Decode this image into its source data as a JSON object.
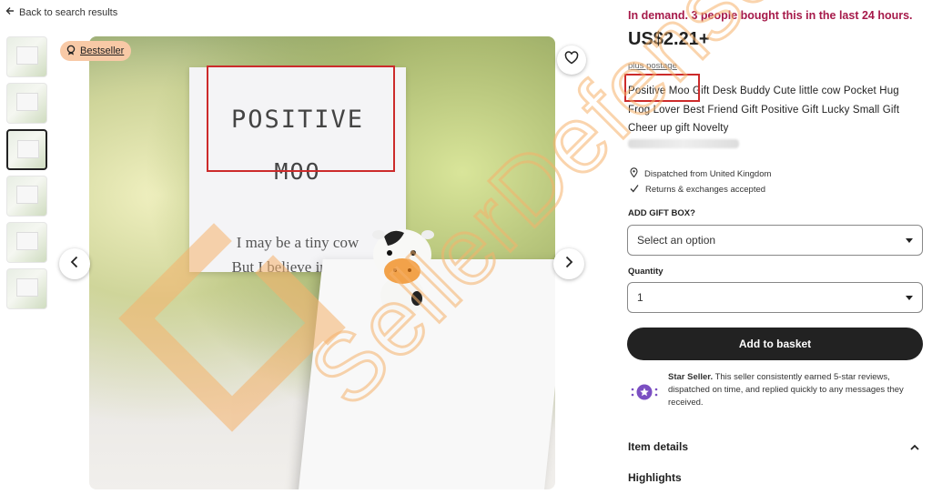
{
  "nav": {
    "back_label": "Back to search results"
  },
  "gallery": {
    "badge_label": "Bestseller",
    "card_line1": "POSITIVE",
    "card_line2": "MOO",
    "card_line3": "I may be a tiny cow",
    "card_line4": "But I believe in you !",
    "thumbnail_count": 6,
    "active_thumbnail": 3
  },
  "product": {
    "demand_text": "In demand. 3 people bought this in the last 24 hours.",
    "price": "US$2.21+",
    "postage_link": "plus postage",
    "title_highlight": "Positive Moo",
    "title_rest": " Gift Desk Buddy Cute little cow Pocket Hug Frog Lover Best Friend Gift Positive Gift Lucky Small Gift Cheer up gift Novelty",
    "dispatched": "Dispatched from United Kingdom",
    "returns": "Returns & exchanges accepted"
  },
  "options": {
    "gift_box_label": "ADD GIFT BOX?",
    "gift_box_value": "Select an option",
    "quantity_label": "Quantity",
    "quantity_value": "1"
  },
  "actions": {
    "add_to_basket": "Add to basket"
  },
  "star_seller": {
    "heading": "Star Seller.",
    "text": " This seller consistently earned 5-star reviews, dispatched on time, and replied quickly to any messages they received."
  },
  "sections": {
    "item_details": "Item details",
    "highlights": "Highlights"
  },
  "watermark": {
    "text": "SellerDefense"
  },
  "colors": {
    "demand": "#a61a4a",
    "badge_bg": "#f8c9a6",
    "annotation_red": "#cc2b2b",
    "star_seller_purple": "#7b4fc2",
    "watermark_orange": "#f6b26b"
  }
}
